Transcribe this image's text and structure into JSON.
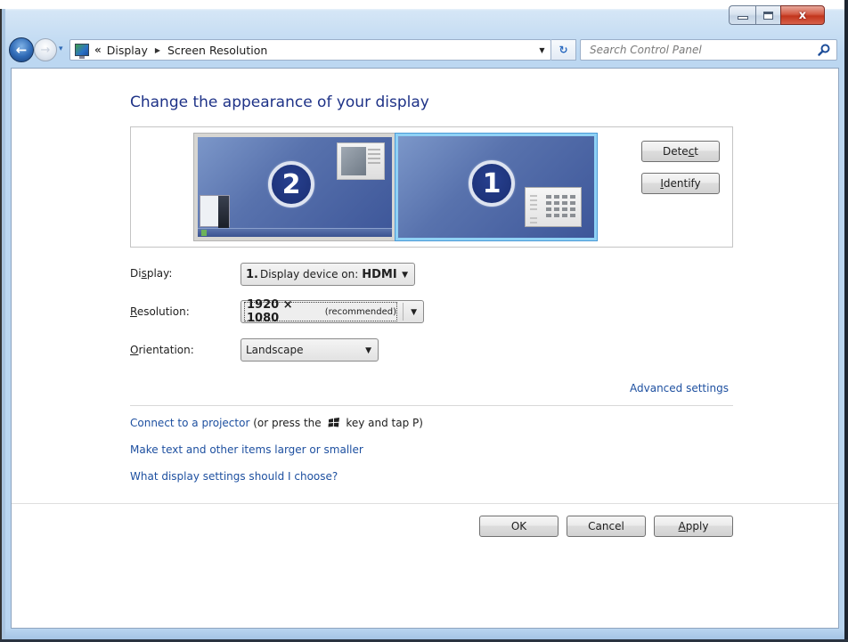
{
  "window": {
    "caption_buttons": {
      "minimize": "minimize",
      "maximize": "maximize",
      "close": "x"
    }
  },
  "nav": {
    "back_icon": "←",
    "forward_icon": "→",
    "recent_icon": "▾",
    "overflow": "«",
    "breadcrumbs": [
      {
        "label": "Display"
      },
      {
        "label": "Screen Resolution"
      }
    ],
    "breadcrumb_separator": "▶",
    "dropdown_arrow": "▼",
    "refresh_icon": "↻",
    "search_placeholder": "Search Control Panel"
  },
  "main": {
    "title": "Change the appearance of your display",
    "monitors": [
      {
        "number": "2",
        "selected": false
      },
      {
        "number": "1",
        "selected": true
      }
    ],
    "detect_button": {
      "pre": "Dete",
      "accel": "c",
      "post": "t"
    },
    "identify_button": {
      "pre": "",
      "accel": "I",
      "post": "dentify"
    },
    "fields": {
      "display": {
        "label_pre": "Di",
        "label_accel": "s",
        "label_post": "play:",
        "value_num": "1.",
        "value_text": "Display device on:",
        "value_port": "HDMI"
      },
      "resolution": {
        "label_pre": "",
        "label_accel": "R",
        "label_post": "esolution:",
        "value_bold": "1920 × 1080",
        "value_note": "(recommended)"
      },
      "orientation": {
        "label_pre": "",
        "label_accel": "O",
        "label_post": "rientation:",
        "value": "Landscape"
      }
    },
    "advanced_link": "Advanced settings",
    "links": {
      "projector_link": "Connect to a projector",
      "projector_hint_pre": "(or press the",
      "projector_hint_post": "key and tap P)",
      "text_size_link": "Make text and other items larger or smaller",
      "help_link": "What display settings should I choose?"
    },
    "buttons": {
      "ok": "OK",
      "cancel": "Cancel",
      "apply_accel": "A",
      "apply_rest": "pply"
    },
    "select_arrow": "▼"
  }
}
